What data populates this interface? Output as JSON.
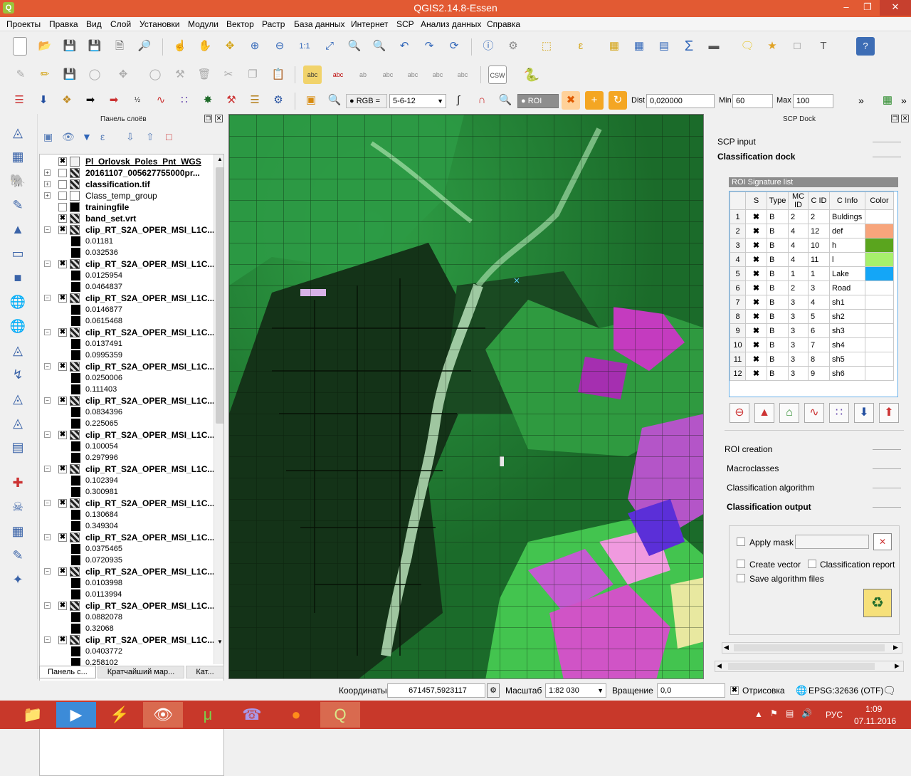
{
  "window": {
    "title": "QGIS2.14.8-Essen",
    "app_icon": "Q",
    "controls": [
      "–",
      "❐",
      "✕"
    ]
  },
  "menu": [
    "Проекты",
    "Правка",
    "Вид",
    "Слой",
    "Установки",
    "Модули",
    "Вектор",
    "Растр",
    "База данных",
    "Интернет",
    "SCP",
    "Анализ данных",
    "Справка"
  ],
  "scp_toolbar": {
    "rgb_label": "RGB =",
    "rgb_value": "5-6-12",
    "roi_label": "ROI",
    "dist_label": "Dist",
    "dist_value": "0,020000",
    "min_label": "Min",
    "min_value": "60",
    "max_label": "Max",
    "max_value": "100",
    "more": "»"
  },
  "layers_panel": {
    "title": "Панель слоёв",
    "layers": [
      {
        "name": "Pl_Orlovsk_Poles_Pnt_WGS",
        "checked": true,
        "bold": true,
        "underline": true,
        "expand": "",
        "icon": "poly"
      },
      {
        "name": "20161107_005627755000pr...",
        "checked": false,
        "bold": true,
        "expand": "+",
        "icon": "raster"
      },
      {
        "name": "classification.tif",
        "checked": false,
        "bold": true,
        "expand": "+",
        "icon": "raster"
      },
      {
        "name": "Class_temp_group",
        "checked": false,
        "bold": false,
        "expand": "+",
        "icon": "group"
      },
      {
        "name": "trainingfile",
        "checked": false,
        "bold": true,
        "expand": "",
        "icon": "black"
      },
      {
        "name": "band_set.vrt",
        "checked": true,
        "bold": true,
        "expand": "",
        "icon": "raster"
      }
    ],
    "clip_layers": [
      {
        "name": "clip_RT_S2A_OPER_MSI_L1C...",
        "min": "0.01181",
        "max": "0.032536"
      },
      {
        "name": "clip_RT_S2A_OPER_MSI_L1C...",
        "min": "0.0125954",
        "max": "0.0464837"
      },
      {
        "name": "clip_RT_S2A_OPER_MSI_L1C...",
        "min": "0.0146877",
        "max": "0.0615468"
      },
      {
        "name": "clip_RT_S2A_OPER_MSI_L1C...",
        "min": "0.0137491",
        "max": "0.0995359"
      },
      {
        "name": "clip_RT_S2A_OPER_MSI_L1C...",
        "min": "0.0250006",
        "max": "0.111403"
      },
      {
        "name": "clip_RT_S2A_OPER_MSI_L1C...",
        "min": "0.0834396",
        "max": "0.225065"
      },
      {
        "name": "clip_RT_S2A_OPER_MSI_L1C...",
        "min": "0.100054",
        "max": "0.297996"
      },
      {
        "name": "clip_RT_S2A_OPER_MSI_L1C...",
        "min": "0.102394",
        "max": "0.300981"
      },
      {
        "name": "clip_RT_S2A_OPER_MSI_L1C...",
        "min": "0.130684",
        "max": "0.349304"
      },
      {
        "name": "clip_RT_S2A_OPER_MSI_L1C...",
        "min": "0.0375465",
        "max": "0.0720935"
      },
      {
        "name": "clip_RT_S2A_OPER_MSI_L1C...",
        "min": "0.0103998",
        "max": "0.0113994"
      },
      {
        "name": "clip_RT_S2A_OPER_MSI_L1C...",
        "min": "0.0882078",
        "max": "0.32068"
      },
      {
        "name": "clip_RT_S2A_OPER_MSI_L1C...",
        "min": "0.0403772",
        "max": "0.258102"
      }
    ],
    "tabs": [
      "Панель с...",
      "Кратчайший мар...",
      "Кат..."
    ]
  },
  "scp_dock": {
    "title": "SCP Dock",
    "scp_input": "SCP input",
    "classification_dock": "Classification dock",
    "roi_list_title": "ROI Signature list",
    "columns": [
      "S",
      "Type",
      "MC ID",
      "C ID",
      "C Info",
      "Color"
    ],
    "rows": [
      {
        "n": "1",
        "type": "B",
        "mc": "2",
        "c": "2",
        "info": "Buldings",
        "color": "#ffffff"
      },
      {
        "n": "2",
        "type": "B",
        "mc": "4",
        "c": "12",
        "info": "def",
        "color": "#f7a57c"
      },
      {
        "n": "3",
        "type": "B",
        "mc": "4",
        "c": "10",
        "info": "h",
        "color": "#5aa51e"
      },
      {
        "n": "4",
        "type": "B",
        "mc": "4",
        "c": "11",
        "info": "l",
        "color": "#a7f06c"
      },
      {
        "n": "5",
        "type": "B",
        "mc": "1",
        "c": "1",
        "info": "Lake",
        "color": "#14a6f7"
      },
      {
        "n": "6",
        "type": "B",
        "mc": "2",
        "c": "3",
        "info": "Road",
        "color": "#ffffff"
      },
      {
        "n": "7",
        "type": "B",
        "mc": "3",
        "c": "4",
        "info": "sh1",
        "color": "#ffffff"
      },
      {
        "n": "8",
        "type": "B",
        "mc": "3",
        "c": "5",
        "info": "sh2",
        "color": "#ffffff"
      },
      {
        "n": "9",
        "type": "B",
        "mc": "3",
        "c": "6",
        "info": "sh3",
        "color": "#ffffff"
      },
      {
        "n": "10",
        "type": "B",
        "mc": "3",
        "c": "7",
        "info": "sh4",
        "color": "#ffffff"
      },
      {
        "n": "11",
        "type": "B",
        "mc": "3",
        "c": "8",
        "info": "sh5",
        "color": "#ffffff"
      },
      {
        "n": "12",
        "type": "B",
        "mc": "3",
        "c": "9",
        "info": "sh6",
        "color": "#ffffff"
      }
    ],
    "roi_creation": "ROI creation",
    "macroclasses": "Macroclasses",
    "classification_algorithm": "Classification algorithm",
    "classification_output": "Classification output",
    "apply_mask": "Apply mask",
    "create_vector": "Create vector",
    "classification_report": "Classification report",
    "save_algorithm_files": "Save algorithm files"
  },
  "statusbar": {
    "coords_label": "Координаты",
    "coords_value": "671457,5923117",
    "scale_label": "Масштаб",
    "scale_value": "1:82 030",
    "rotation_label": "Вращение",
    "rotation_value": "0,0",
    "render_label": "Отрисовка",
    "crs": "EPSG:32636 (OTF)"
  },
  "taskbar": {
    "lang": "РУС",
    "time": "1:09",
    "date": "07.11.2016"
  }
}
